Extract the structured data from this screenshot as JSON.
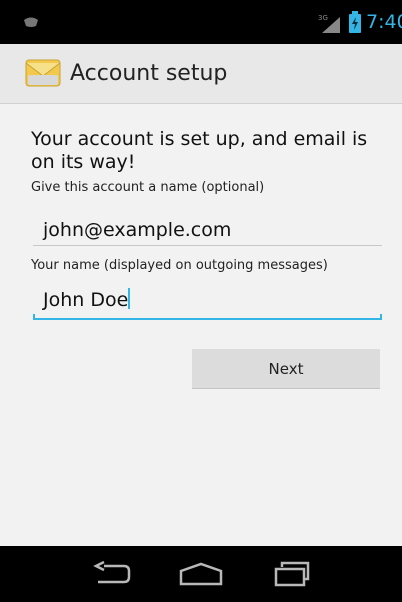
{
  "status_bar": {
    "signal_label": "3G",
    "time": "7:40",
    "accent_color": "#33b5e5",
    "icons": [
      "notification-icon",
      "signal-icon",
      "battery-icon"
    ]
  },
  "action_bar": {
    "title": "Account setup",
    "icon": "email-app-icon"
  },
  "content": {
    "headline": "Your account is set up, and email is on its way!",
    "account_name": {
      "label": "Give this account a name (optional)",
      "value": "john@example.com"
    },
    "your_name": {
      "label": "Your name (displayed on outgoing messages)",
      "value": "John Doe",
      "focused": true
    },
    "next_label": "Next"
  },
  "nav_bar": {
    "icons": [
      "back-icon",
      "home-icon",
      "recent-apps-icon"
    ]
  }
}
